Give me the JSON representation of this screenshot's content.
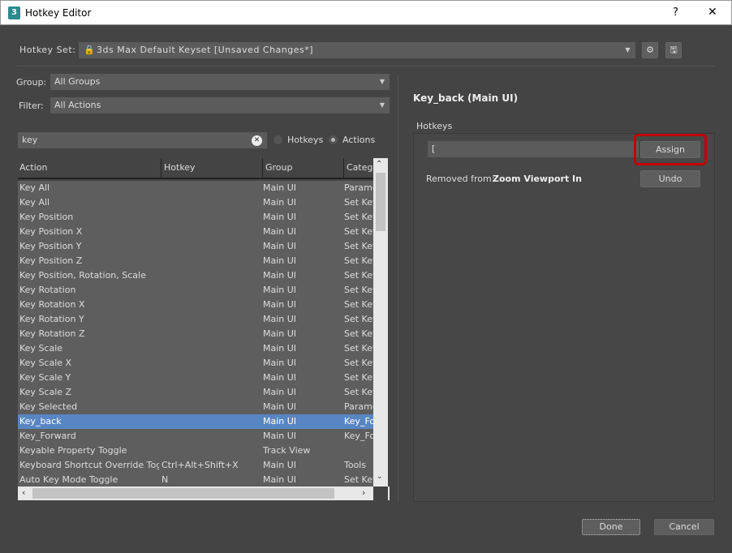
{
  "window": {
    "title": "Hotkey Editor",
    "help": "?",
    "close": "✕",
    "app_icon": "3"
  },
  "hotkey_set": {
    "label": "Hotkey Set:",
    "value": "3ds Max Default Keyset [Unsaved Changes*]"
  },
  "group": {
    "label": "Group:",
    "value": "All Groups"
  },
  "filter": {
    "label": "Filter:",
    "value": "All Actions"
  },
  "search": {
    "value": "key"
  },
  "mode": {
    "hotkeys": "Hotkeys",
    "actions": "Actions",
    "selected": "Actions"
  },
  "columns": [
    "Action",
    "Hotkey",
    "Group",
    "Categc"
  ],
  "rows": [
    [
      "Key All",
      "",
      "Main UI",
      "Parame"
    ],
    [
      "Key All",
      "",
      "Main UI",
      "Set Key"
    ],
    [
      "Key Position",
      "",
      "Main UI",
      "Set Key"
    ],
    [
      "Key Position X",
      "",
      "Main UI",
      "Set Key"
    ],
    [
      "Key Position Y",
      "",
      "Main UI",
      "Set Key"
    ],
    [
      "Key Position Z",
      "",
      "Main UI",
      "Set Key"
    ],
    [
      "Key Position, Rotation, Scale",
      "",
      "Main UI",
      "Set Key"
    ],
    [
      "Key Rotation",
      "",
      "Main UI",
      "Set Key"
    ],
    [
      "Key Rotation X",
      "",
      "Main UI",
      "Set Key"
    ],
    [
      "Key Rotation Y",
      "",
      "Main UI",
      "Set Key"
    ],
    [
      "Key Rotation Z",
      "",
      "Main UI",
      "Set Key"
    ],
    [
      "Key Scale",
      "",
      "Main UI",
      "Set Key"
    ],
    [
      "Key Scale X",
      "",
      "Main UI",
      "Set Key"
    ],
    [
      "Key Scale Y",
      "",
      "Main UI",
      "Set Key"
    ],
    [
      "Key Scale Z",
      "",
      "Main UI",
      "Set Key"
    ],
    [
      "Key Selected",
      "",
      "Main UI",
      "Parame"
    ],
    [
      "Key_back",
      "",
      "Main UI",
      "Key_Fo"
    ],
    [
      "Key_Forward",
      "",
      "Main UI",
      "Key_Fo"
    ],
    [
      "Keyable Property Toggle",
      "",
      "Track View",
      ""
    ],
    [
      "Keyboard Shortcut Override Tog...",
      "Ctrl+Alt+Shift+X",
      "Main UI",
      "Tools"
    ],
    [
      "Auto Key Mode Toggle",
      "N",
      "Main UI",
      "Set Key"
    ]
  ],
  "selected_row": 16,
  "detail": {
    "title": "Key_back (Main UI)",
    "hotkeys_label": "Hotkeys",
    "hotkey_value": "[",
    "assign": "Assign",
    "removed_label": "Removed from:",
    "removed_value": "Zoom Viewport In",
    "undo": "Undo"
  },
  "footer": {
    "done": "Done",
    "cancel": "Cancel"
  },
  "colors": {
    "highlight": "#c00000",
    "selection": "#5886c3"
  }
}
